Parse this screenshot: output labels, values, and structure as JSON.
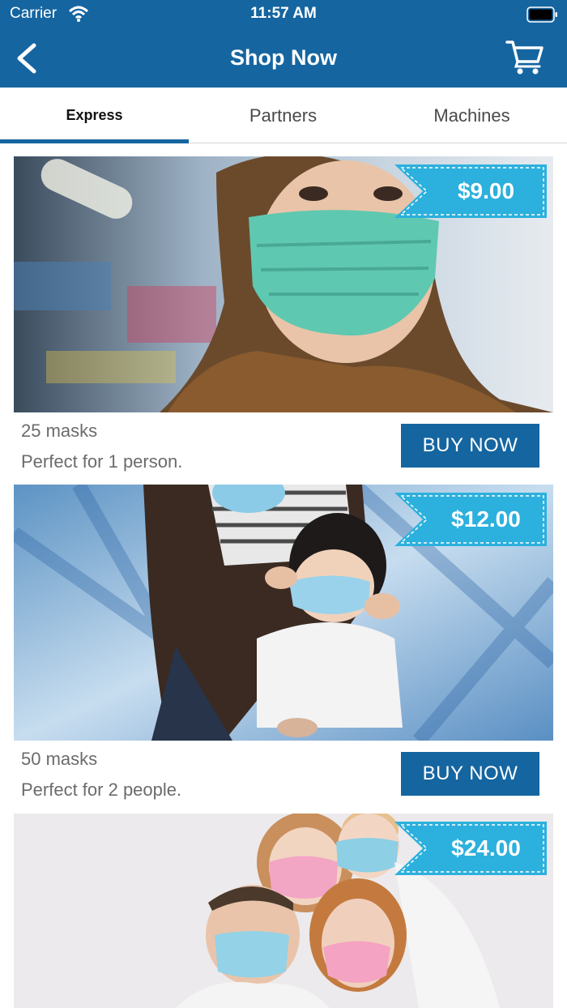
{
  "status_bar": {
    "carrier": "Carrier",
    "time": "11:57 AM"
  },
  "header": {
    "title": "Shop Now",
    "back_icon": "chevron-left-icon",
    "cart_icon": "cart-icon"
  },
  "tabs": [
    {
      "label": "Express",
      "active": true
    },
    {
      "label": "Partners",
      "active": false
    },
    {
      "label": "Machines",
      "active": false
    }
  ],
  "products": [
    {
      "price": "$9.00",
      "quantity": "25 masks",
      "description": "Perfect for 1 person.",
      "button": "BUY NOW"
    },
    {
      "price": "$12.00",
      "quantity": "50 masks",
      "description": "Perfect for 2 people.",
      "button": "BUY NOW"
    },
    {
      "price": "$24.00"
    }
  ],
  "colors": {
    "primary": "#1565a0",
    "price_tag": "#2cb0dd",
    "text_muted": "#6b6b6b"
  }
}
